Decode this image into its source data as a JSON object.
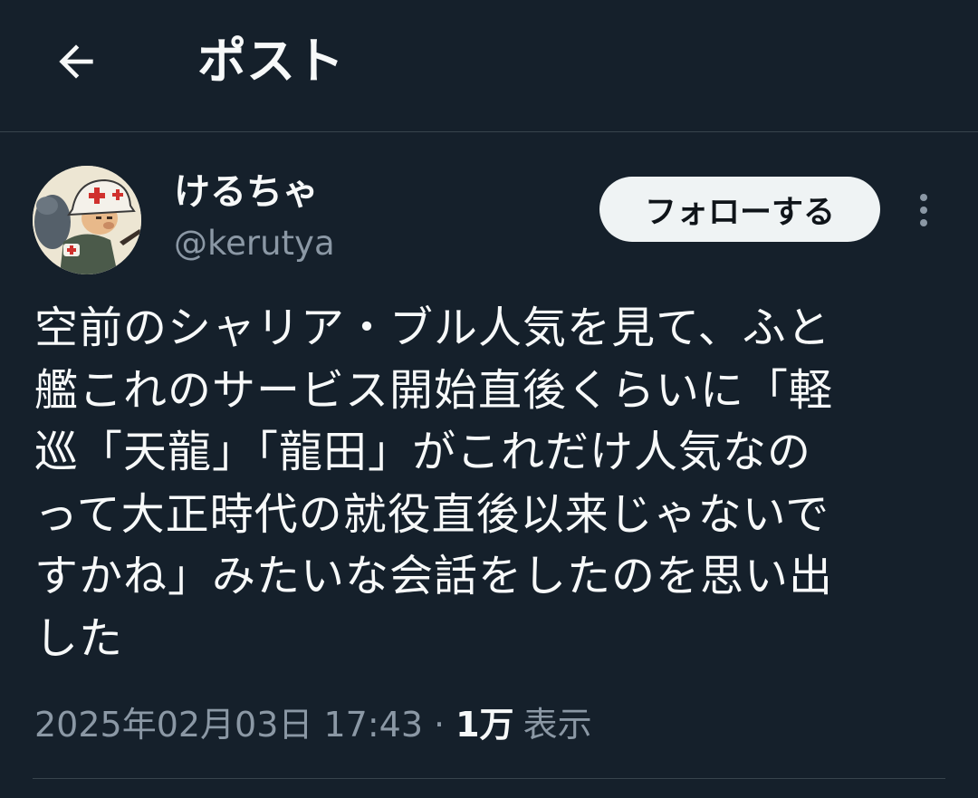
{
  "header": {
    "title": "ポスト",
    "back_icon": "arrow-left-icon"
  },
  "author": {
    "display_name": "けるちゃ",
    "handle": "@kerutya",
    "avatar_icon": "avatar-illustration"
  },
  "follow_button": {
    "label": "フォローする"
  },
  "more_icon": "more-vertical-icon",
  "tweet": {
    "lines": [
      "空前のシャリア・ブル人気を見て、ふと",
      "艦これのサービス開始直後くらいに「軽",
      "巡「天龍」「龍田」がこれだけ人気なの",
      "って大正時代の就役直後以来じゃないで",
      "すかね」みたいな会話をしたのを思い出",
      "した"
    ]
  },
  "meta": {
    "timestamp": "2025年02月03日 17:43",
    "separator": "·",
    "views_count": "1万",
    "views_label": "表示"
  },
  "colors": {
    "background": "#15202b",
    "text_primary": "#f7f9f9",
    "text_secondary": "#8b98a5",
    "divider": "#38444d",
    "follow_button_bg": "#eff3f4",
    "follow_button_text": "#0f1419"
  }
}
